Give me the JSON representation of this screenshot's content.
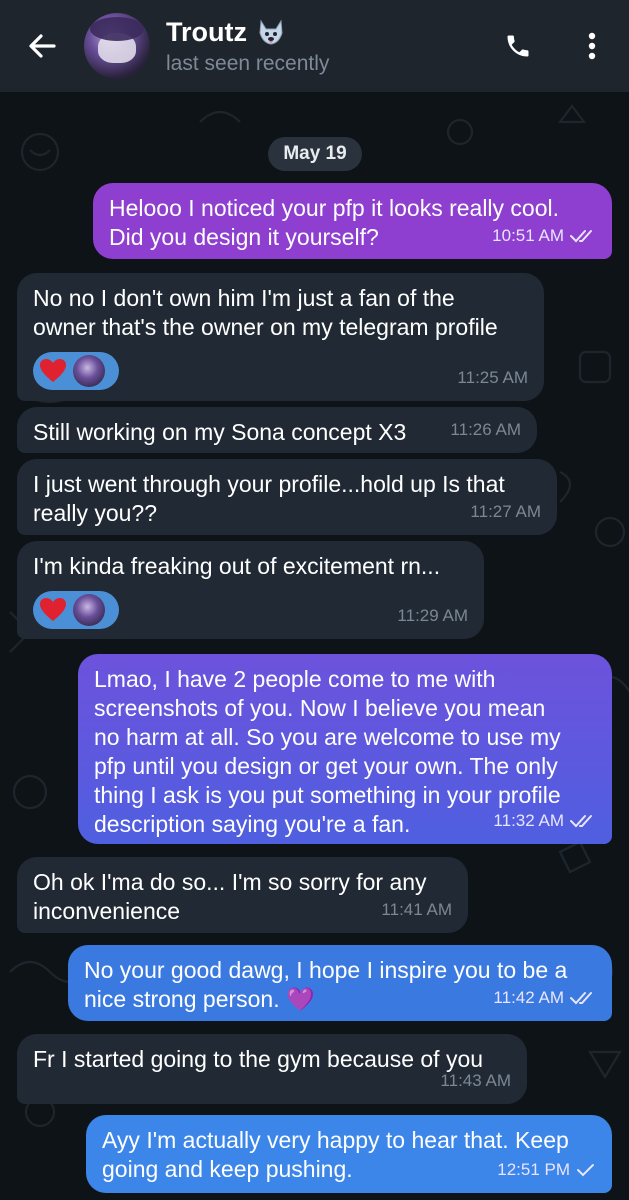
{
  "header": {
    "contact_name": "Troutz",
    "status": "last seen recently",
    "icons": [
      "back-arrow-icon",
      "phone-icon",
      "more-vertical-icon",
      "wolf-emoji-icon"
    ]
  },
  "chat": {
    "date_label": "May 19",
    "colors": {
      "incoming": "#212a34",
      "outgoing_purple": "#8e3fd0",
      "outgoing_blue": "#3a7ae0",
      "reaction_pill": "#4b8fd6"
    },
    "messages": [
      {
        "id": "m1",
        "direction": "out",
        "text": "Helooo I noticed your pfp it looks really cool.\nDid you design it yourself?",
        "time": "10:51 AM",
        "read": true
      },
      {
        "id": "m2",
        "direction": "in",
        "text": "No no I don't own him I'm just a fan of the\nowner that's the owner on my telegram profile",
        "time": "11:25 AM",
        "reactions": [
          "heart",
          "avatar"
        ]
      },
      {
        "id": "m3",
        "direction": "in",
        "text": "Still working on my Sona concept X3",
        "time": "11:26 AM"
      },
      {
        "id": "m4",
        "direction": "in",
        "text": "I just went through your profile...hold up Is that\nreally you??",
        "time": "11:27 AM"
      },
      {
        "id": "m5",
        "direction": "in",
        "text": "I'm kinda freaking out of excitement rn...",
        "time": "11:29 AM",
        "reactions": [
          "heart",
          "avatar"
        ]
      },
      {
        "id": "m6",
        "direction": "out",
        "text": "Lmao, I have 2 people come to me with\nscreenshots of you. Now I believe you mean\nno harm at all. So you are welcome to use my\npfp until you design or get your own. The only\nthing I ask is you put something in your profile\ndescription saying you're a fan.",
        "time": "11:32 AM",
        "read": true
      },
      {
        "id": "m7",
        "direction": "in",
        "text": "Oh ok I'ma do so... I'm so sorry for any\ninconvenience",
        "time": "11:41 AM"
      },
      {
        "id": "m8",
        "direction": "out",
        "text": "No your good dawg, I hope I inspire you to be a\nnice strong person. 💜",
        "time": "11:42 AM",
        "read": true
      },
      {
        "id": "m9",
        "direction": "in",
        "text": "Fr I started going to the gym because of you",
        "time": "11:43 AM"
      },
      {
        "id": "m10",
        "direction": "out",
        "text": "Ayy I'm actually very happy to hear that. Keep\ngoing and keep pushing.",
        "time": "12:51 PM",
        "read": false
      }
    ]
  }
}
